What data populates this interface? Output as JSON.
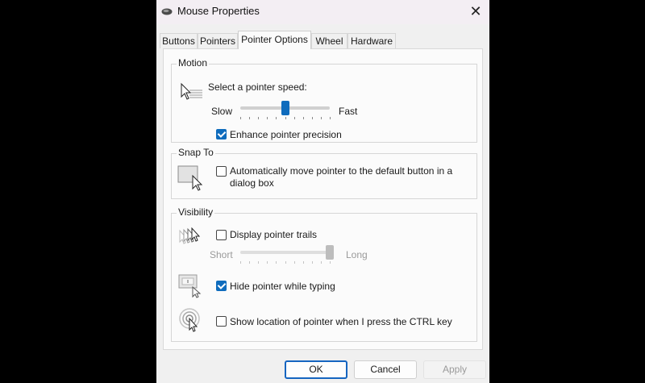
{
  "window": {
    "title": "Mouse Properties",
    "close_glyph": "✕"
  },
  "tabs": [
    {
      "label": "Buttons"
    },
    {
      "label": "Pointers"
    },
    {
      "label": "Pointer Options",
      "active": true
    },
    {
      "label": "Wheel"
    },
    {
      "label": "Hardware"
    }
  ],
  "motion": {
    "group_label": "Motion",
    "speed_label": "Select a pointer speed:",
    "slow_label": "Slow",
    "fast_label": "Fast",
    "speed_value": 0.5,
    "enhance_label": "Enhance pointer precision",
    "enhance_checked": true
  },
  "snap_to": {
    "group_label": "Snap To",
    "auto_move_label_line1": "Automatically move pointer to the default button in a",
    "auto_move_label_line2": "dialog box",
    "auto_move_checked": false
  },
  "visibility": {
    "group_label": "Visibility",
    "trails_label": "Display pointer trails",
    "trails_checked": false,
    "short_label": "Short",
    "long_label": "Long",
    "trails_value": 1.0,
    "hide_label": "Hide pointer while typing",
    "hide_checked": true,
    "ctrl_label": "Show location of pointer when I press the CTRL key",
    "ctrl_checked": false
  },
  "buttons": {
    "ok": "OK",
    "cancel": "Cancel",
    "apply": "Apply"
  },
  "colors": {
    "accent": "#0f6cbd",
    "default_border": "#1565c0"
  },
  "icons": [
    "mouse-icon",
    "close-icon",
    "pointer-speed-icon",
    "snap-to-icon",
    "pointer-trails-icon",
    "hide-pointer-icon",
    "locate-pointer-icon"
  ]
}
